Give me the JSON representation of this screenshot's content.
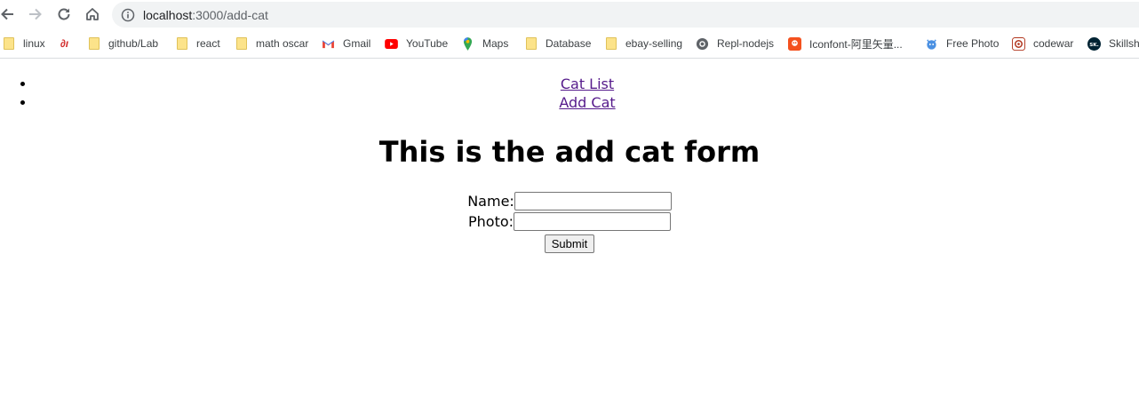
{
  "browser": {
    "url_host": "localhost",
    "url_path": ":3000/add-cat",
    "bookmarks": [
      {
        "label": "linux",
        "icon": "folder-icon"
      },
      {
        "label": "",
        "icon": "a-logo-icon"
      },
      {
        "label": "github/Lab",
        "icon": "folder-icon"
      },
      {
        "label": "react",
        "icon": "folder-icon"
      },
      {
        "label": "math oscar",
        "icon": "folder-icon"
      },
      {
        "label": "Gmail",
        "icon": "gmail-icon"
      },
      {
        "label": "YouTube",
        "icon": "youtube-icon"
      },
      {
        "label": "Maps",
        "icon": "maps-icon"
      },
      {
        "label": "Database",
        "icon": "folder-icon"
      },
      {
        "label": "ebay-selling",
        "icon": "folder-icon"
      },
      {
        "label": "Repl-nodejs",
        "icon": "replit-icon"
      },
      {
        "label": "Iconfont-阿里矢量...",
        "icon": "iconfont-icon"
      },
      {
        "label": "Free Photo",
        "icon": "free-photo-icon"
      },
      {
        "label": "codewar",
        "icon": "codewars-icon"
      },
      {
        "label": "Skillsha",
        "icon": "skillshare-icon"
      }
    ]
  },
  "nav": {
    "cat_list": "Cat List",
    "add_cat": "Add Cat"
  },
  "page": {
    "title": "This is the add cat form"
  },
  "form": {
    "name_label": "Name:",
    "name_value": "",
    "photo_label": "Photo:",
    "photo_value": "",
    "submit_label": "Submit"
  }
}
